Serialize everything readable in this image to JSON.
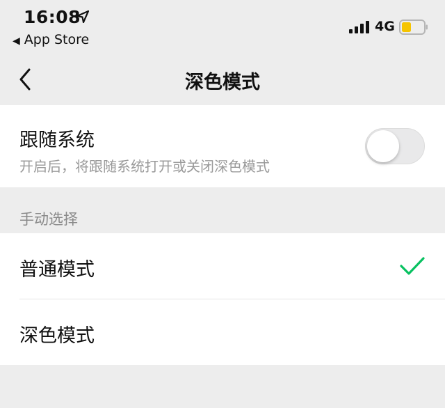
{
  "status_bar": {
    "time": "16:08",
    "back_app": "App Store",
    "network": "4G",
    "icons": [
      "location-arrow-icon",
      "signal-bars-icon",
      "battery-icon"
    ],
    "battery_color": "#f5c400"
  },
  "nav": {
    "title": "深色模式",
    "back_icon": "chevron-left-icon"
  },
  "follow_system": {
    "title": "跟随系统",
    "description": "开启后，将跟随系统打开或关闭深色模式",
    "toggle_on": false
  },
  "manual": {
    "header": "手动选择",
    "options": [
      {
        "label": "普通模式",
        "selected": true
      },
      {
        "label": "深色模式",
        "selected": false
      }
    ],
    "check_color": "#07c160"
  }
}
